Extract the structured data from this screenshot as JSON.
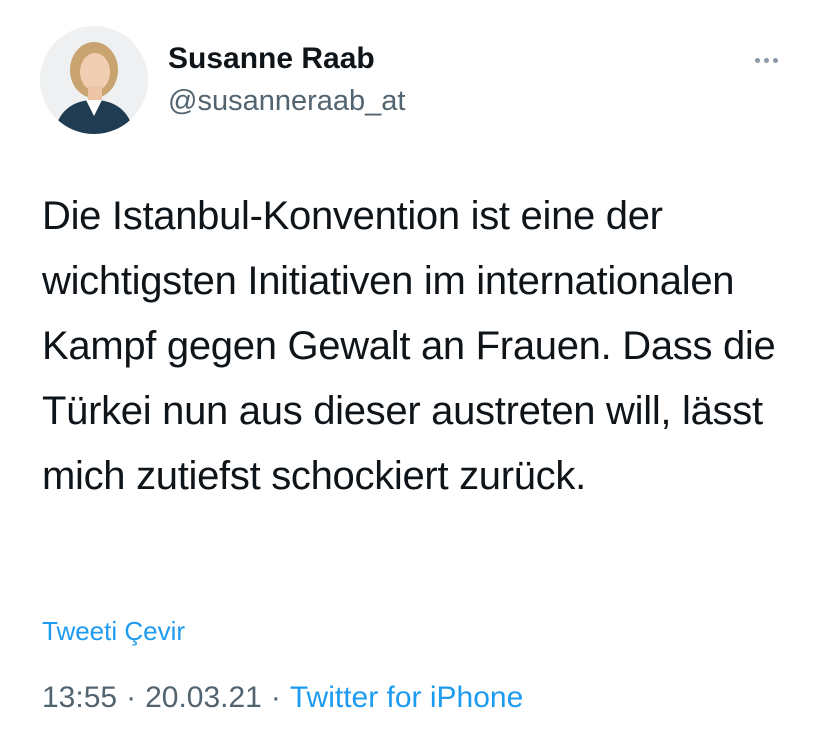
{
  "tweet": {
    "author": {
      "name": "Susanne Raab",
      "handle": "@susanneraab_at"
    },
    "text": "Die Istanbul-Konvention ist eine der wichtigsten Initiativen im internationalen Kampf gegen Gewalt an Frauen. Dass die Türkei nun aus dieser austreten will, lässt mich zutiefst schockiert zurück.",
    "translate_label": "Tweeti Çevir",
    "time": "13:55",
    "separator": "·",
    "date": "20.03.21",
    "source": "Twitter for iPhone",
    "more_icon": "more-horizontal-icon"
  },
  "colors": {
    "link": "#1d9bf0",
    "secondary_text": "#536471",
    "primary_text": "#0f1419"
  }
}
